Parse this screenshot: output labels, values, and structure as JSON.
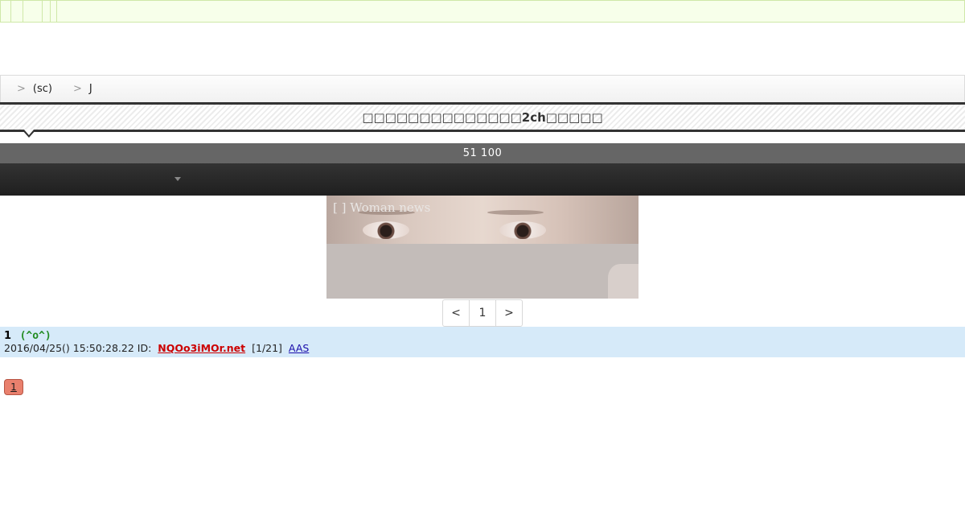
{
  "breadcrumb": {
    "items": [
      {
        "label": "(sc)"
      },
      {
        "label": "J"
      }
    ]
  },
  "thread": {
    "title": "□□□□□□□□□□□□□□2ch□□□□□",
    "count_text": "51 100"
  },
  "banner": {
    "caption": "[ ] Woman news"
  },
  "pagination": {
    "prev_label": "<",
    "current_label": "1",
    "next_label": ">"
  },
  "post": {
    "number": "1",
    "name": "(^o^)",
    "date": "2016/04/25() 15:50:28.22 ID:",
    "id": "NQOo3iMOr.net",
    "count": "[1/21]",
    "aas_label": "AAS"
  },
  "reply_badge": {
    "label": "1",
    "color": "#e9806d"
  },
  "colors": {
    "post_background": "#d6eaf9",
    "count_bar": "#666666",
    "nav_bar": "#262626",
    "id_link": "#cc0000",
    "name": "#228b22"
  }
}
